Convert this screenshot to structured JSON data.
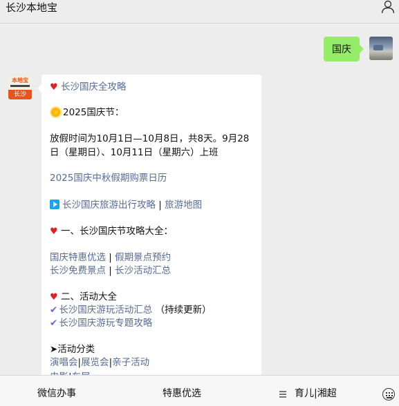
{
  "header": {
    "title": "长沙本地宝",
    "profile_icon": "user-icon"
  },
  "chat": {
    "user_message": "国庆",
    "bot_avatar": {
      "brand": "本地宝",
      "city": "长沙"
    },
    "reply": {
      "guide_link": "长沙国庆全攻略",
      "holiday_heading": "2025国庆节：",
      "holiday_line1": "放假时间为10月1日—10月8日，共8天。9月28",
      "holiday_line2": "日（星期日）、10月11日（星期六）上班",
      "ticket_calendar_link": "2025国庆中秋假期购票日历",
      "travel_guide_link": "长沙国庆旅游出行攻略",
      "separator": "|",
      "travel_map_link": "旅游地图",
      "section1_heading": "一、长沙国庆节攻略大全：",
      "deals_link": "国庆特惠优选",
      "scenic_booking_link": "假期景点预约",
      "free_scenic_link": "长沙免费景点",
      "activities_summary_link": "长沙活动汇总",
      "section2_heading": "二、活动大全",
      "fun_activities_link": "长沙国庆游玩活动汇总",
      "fun_activities_note": "（持续更新）",
      "topic_guide_link": "长沙国庆游玩专题攻略",
      "category_heading": "➤活动分类",
      "concert_link": "演唱会",
      "exhibition_link": "展览会",
      "family_link": "亲子活动",
      "movie_link": "电影",
      "fair_link": "车展"
    }
  },
  "bottom_menu": {
    "items": [
      "微信办事",
      "特惠优选",
      "育儿|湘超"
    ],
    "keyboard_icon": "keyboard-icon",
    "menu_icon": "menu-icon"
  },
  "colors": {
    "background": "#ededed",
    "user_bubble": "#95ec69",
    "link": "#576b95",
    "brand_orange": "#e8541b"
  }
}
